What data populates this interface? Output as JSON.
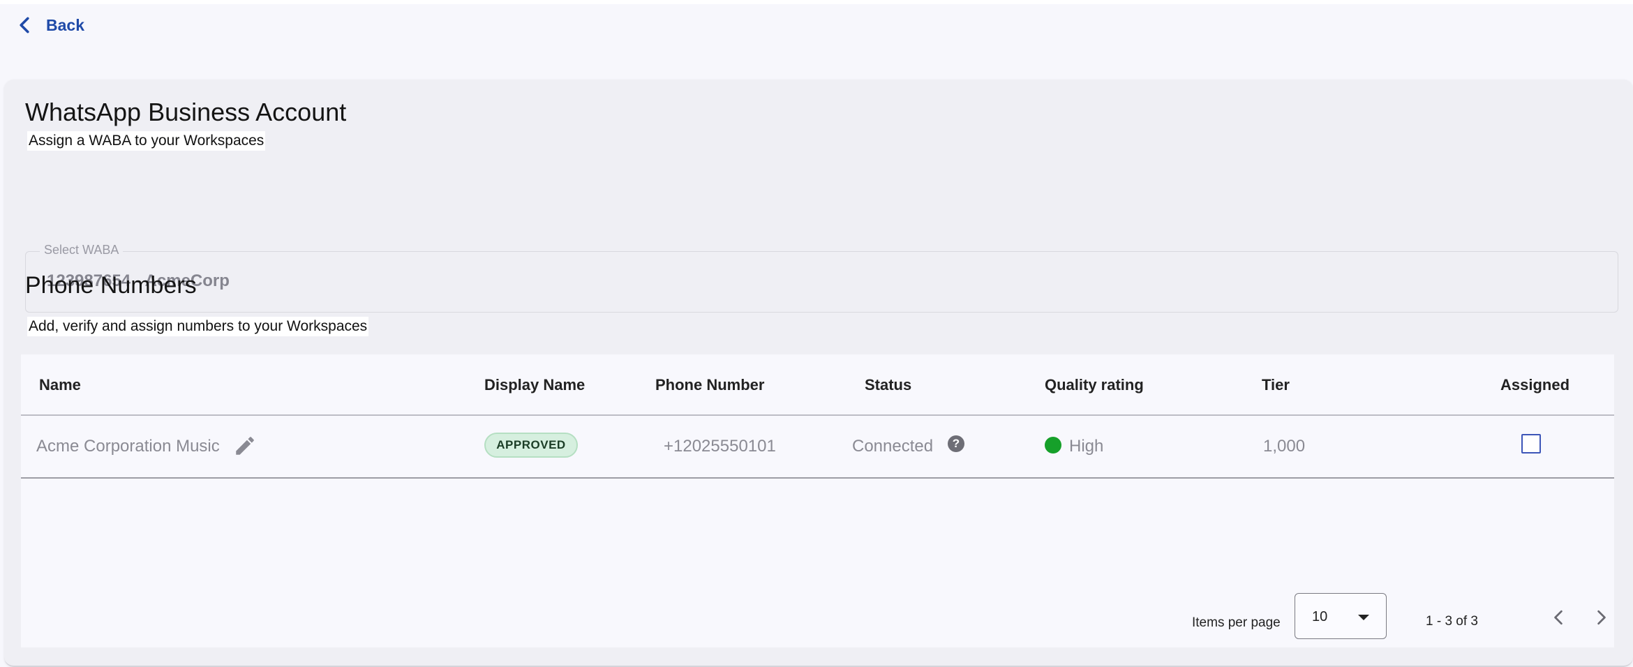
{
  "nav": {
    "back_label": "Back"
  },
  "waba_section": {
    "title": "WhatsApp Business Account",
    "subtitle": "Assign a WABA to your Workspaces",
    "select_label": "Select WABA",
    "select_value": "123987654 - AcmeCorp"
  },
  "phone_section": {
    "title": "Phone Numbers",
    "subtitle": "Add, verify and assign numbers to your Workspaces"
  },
  "table": {
    "headers": {
      "name": "Name",
      "display_name": "Display Name",
      "phone_number": "Phone Number",
      "status": "Status",
      "quality_rating": "Quality rating",
      "tier": "Tier",
      "assigned": "Assigned"
    },
    "rows": [
      {
        "name": "Acme Corporation Music",
        "display_name_status": "APPROVED",
        "phone_number": "+12025550101",
        "status": "Connected",
        "quality_rating": "High",
        "quality_color": "#16a02a",
        "tier": "1,000",
        "assigned": false
      }
    ]
  },
  "paginator": {
    "items_per_page_label": "Items per page",
    "items_per_page_value": "10",
    "range_label": "1 - 3 of 3"
  },
  "icons": {
    "back": "chevron-left-icon",
    "edit": "pencil-icon",
    "help": "help-circle-icon",
    "prev": "chevron-left-icon",
    "next": "chevron-right-icon"
  },
  "colors": {
    "accent": "#1f4aa8",
    "badge_bg": "#d6efdf",
    "checkbox_border": "#3d55b8"
  }
}
